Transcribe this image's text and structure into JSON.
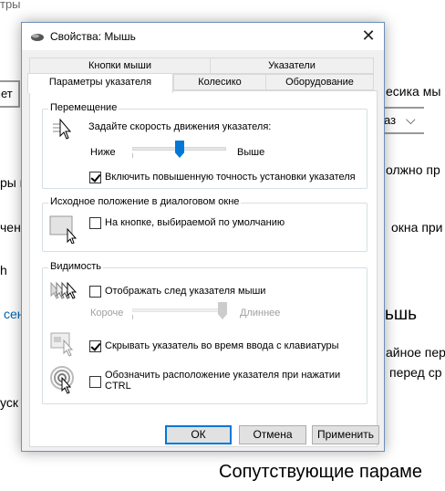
{
  "background": {
    "frag_top": "тры",
    "frag_mouse_wheel": "есика мы",
    "frag_dropdown": "аз",
    "frag_left1": "ры и",
    "frag_should": "олжно пр",
    "frag_left2": "чен",
    "frag_window": "окна при",
    "frag_h": "h",
    "frag_link": "сен",
    "frag_mouse": "ьшь",
    "frag_ainoe": "айное пер",
    "frag_before": "перед ср",
    "frag_usk": "уск",
    "frag_related": "Сопутствующие параме",
    "frag_left_box": "мет"
  },
  "dialog": {
    "title": "Свойства: Мышь",
    "close_symbol": "✕",
    "tabs_row1": [
      "Кнопки мыши",
      "Указатели"
    ],
    "tabs_row2": [
      "Параметры указателя",
      "Колесико",
      "Оборудование"
    ],
    "active_tab": "Параметры указателя",
    "motion": {
      "title": "Перемещение",
      "prompt": "Задайте скорость движения указателя:",
      "slow": "Ниже",
      "fast": "Выше",
      "speed_level": 0.5,
      "precision_label": "Включить повышенную точность установки указателя",
      "precision_checked": true
    },
    "snap": {
      "title": "Исходное положение в диалоговом окне",
      "label": "На кнопке, выбираемой по умолчанию",
      "checked": false
    },
    "visibility": {
      "title": "Видимость",
      "trails_label": "Отображать след указателя мыши",
      "trails_checked": false,
      "short": "Короче",
      "long": "Длиннее",
      "trail_level": 1.0,
      "hide_label": "Скрывать указатель во время ввода с клавиатуры",
      "hide_checked": true,
      "ctrl_label_line1": "Обозначить расположение указателя при нажатии",
      "ctrl_label_line2": "CTRL",
      "ctrl_checked": false
    },
    "buttons": {
      "ok": "ОК",
      "cancel": "Отмена",
      "apply": "Применить"
    }
  },
  "colors": {
    "accent": "#0078d7",
    "link": "#0063b1"
  }
}
